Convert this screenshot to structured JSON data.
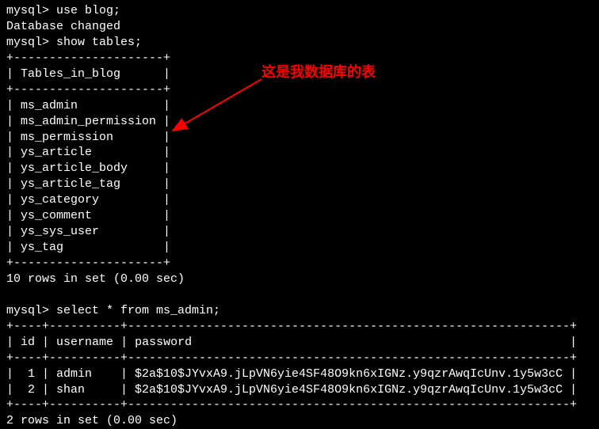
{
  "prompt": "mysql> ",
  "commands": {
    "use_db": "use blog;",
    "db_changed": "Database changed",
    "show_tables": "show tables;",
    "select_admin": "select * from ms_admin;"
  },
  "tables_header": "Tables_in_blog",
  "tables": [
    "ms_admin",
    "ms_admin_permission",
    "ms_permission",
    "ys_article",
    "ys_article_body",
    "ys_article_tag",
    "ys_category",
    "ys_comment",
    "ys_sys_user",
    "ys_tag"
  ],
  "table_sep_top": "+---------------------+",
  "table_row_fmt_header": "| Tables_in_blog      |",
  "rows_in_set_1": "10 rows in set (0.00 sec)",
  "admin_header_sep": "+----+----------+--------------------------------------------------------------+",
  "admin_columns": {
    "id": "id",
    "username": "username",
    "password": "password"
  },
  "admin_rows": [
    {
      "id": "1",
      "username": "admin",
      "password": "$2a$10$JYvxA9.jLpVN6yie4SF48O9kn6xIGNz.y9qzrAwqIcUnv.1y5w3cC"
    },
    {
      "id": "2",
      "username": "shan",
      "password": "$2a$10$JYvxA9.jLpVN6yie4SF48O9kn6xIGNz.y9qzrAwqIcUnv.1y5w3cC"
    }
  ],
  "rows_in_set_2": "2 rows in set (0.00 sec)",
  "annotation_text": "这是我数据库的表"
}
